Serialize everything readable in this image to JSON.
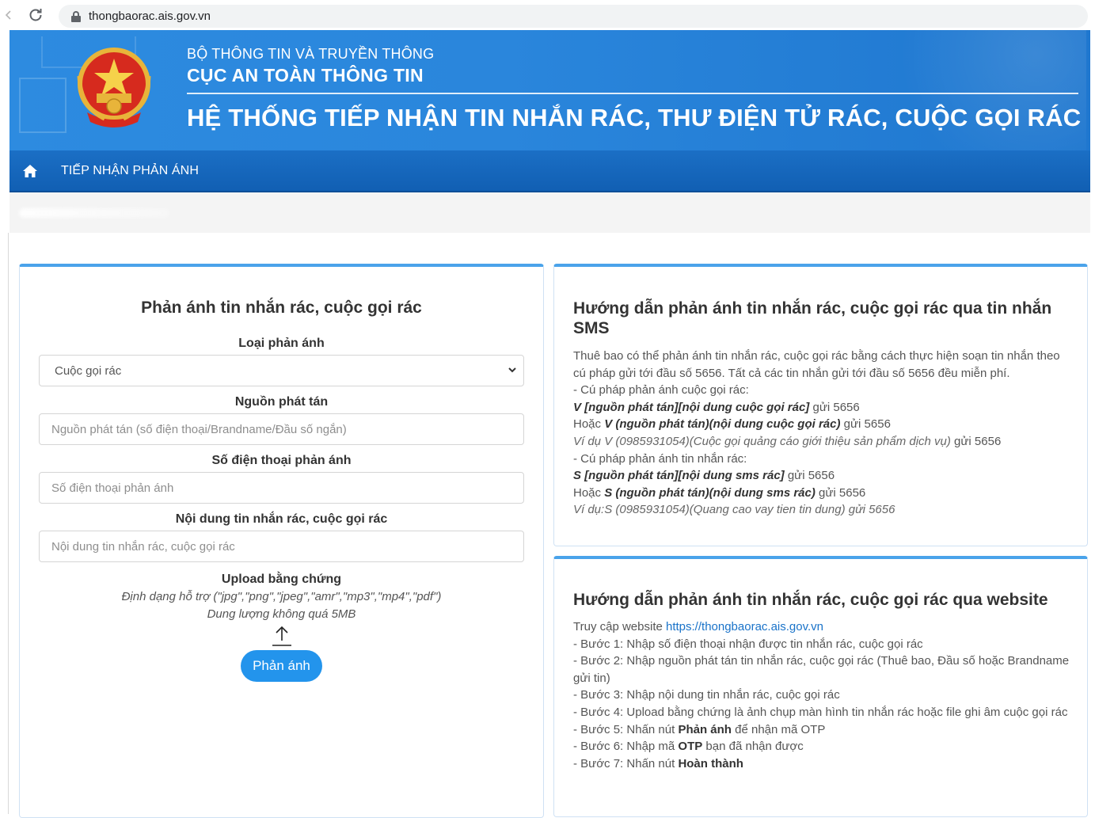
{
  "browser": {
    "url": "thongbaorac.ais.gov.vn"
  },
  "header": {
    "ministry": "BỘ THÔNG TIN VÀ TRUYỀN THÔNG",
    "agency": "CỤC AN TOÀN THÔNG TIN",
    "system_title": "HỆ THỐNG TIẾP NHẬN TIN NHẮN RÁC, THƯ ĐIỆN TỬ RÁC, CUỘC GỌI RÁC"
  },
  "nav": {
    "link": "TIẾP NHẬN PHẢN ÁNH"
  },
  "form": {
    "title": "Phản ánh tin nhắn rác, cuộc gọi rác",
    "type_label": "Loại phản ánh",
    "type_value": "Cuộc gọi rác",
    "source_label": "Nguồn phát tán",
    "source_placeholder": "Nguồn phát tán (số điện thoại/Brandname/Đầu số ngắn)",
    "phone_label": "Số điện thoại phản ánh",
    "phone_placeholder": "Số điện thoại phản ánh",
    "content_label": "Nội dung tin nhắn rác, cuộc gọi rác",
    "content_placeholder": "Nội dung tin nhắn rác, cuộc gọi rác",
    "upload_label": "Upload bằng chứng",
    "upload_formats": "Định dạng hỗ trợ (\"jpg\",\"png\",\"jpeg\",\"amr\",\"mp3\",\"mp4\",\"pdf\")",
    "upload_size": "Dung lượng không quá 5MB",
    "submit_label": "Phản ánh"
  },
  "sms_guide": {
    "title": "Hướng dẫn phản ánh tin nhắn rác, cuộc gọi rác qua tin nhắn SMS",
    "intro": "Thuê bao có thể phản ánh tin nhắn rác, cuộc gọi rác bằng cách thực hiện soạn tin nhắn theo cú pháp gửi tới đầu số 5656. Tất cả các tin nhắn gửi tới đầu số 5656 đều miễn phí.",
    "call_heading": "- Cú pháp phản ánh cuộc gọi rác:",
    "call_syntax1": "V [nguồn phát tán][nội dung cuộc gọi rác]",
    "call_send1": " gửi 5656",
    "call_or": "Hoặc ",
    "call_syntax2": "V (nguồn phát tán)(nội dung cuộc gọi rác)",
    "call_send2": " gửi 5656",
    "call_example": "Ví dụ V (0985931054)(Cuộc gọi quảng cáo giới thiệu sản phẩm dịch vụ)",
    "call_example_send": " gửi 5656",
    "sms_heading": "- Cú pháp phản ánh tin nhắn rác:",
    "sms_syntax1": "S [nguồn phát tán][nội dung sms rác]",
    "sms_send1": " gửi 5656",
    "sms_or": "Hoặc ",
    "sms_syntax2": "S (nguồn phát tán)(nội dung sms rác)",
    "sms_send2": " gửi 5656",
    "sms_example": "Ví dụ:S (0985931054)(Quang cao vay tien tin dung) gửi 5656"
  },
  "web_guide": {
    "title": "Hướng dẫn phản ánh tin nhắn rác, cuộc gọi rác qua website",
    "access": "Truy cập website ",
    "access_link": "https://thongbaorac.ais.gov.vn",
    "step1": "- Bước 1: Nhập số điện thoại nhận được tin nhắn rác, cuộc gọi rác",
    "step2": "- Bước 2: Nhập nguồn phát tán tin nhắn rác, cuộc gọi rác (Thuê bao, Đầu số hoặc Brandname gửi tin)",
    "step3": "- Bước 3: Nhập nội dung tin nhắn rác, cuộc gọi rác",
    "step4": "- Bước 4: Upload bằng chứng là ảnh chụp màn hình tin nhắn rác hoặc file ghi âm cuộc gọi rác",
    "step5_pre": "- Bước 5: Nhấn nút ",
    "step5_bold": "Phản ánh",
    "step5_post": " để nhận mã OTP",
    "step6_pre": "- Bước 6: Nhập mã ",
    "step6_bold": "OTP",
    "step6_post": " bạn đã nhận được",
    "step7_pre": "- Bước 7: Nhấn nút ",
    "step7_bold": "Hoàn thành"
  },
  "colors": {
    "header_blue": "#2a86dc",
    "nav_blue": "#115fb3",
    "panel_accent": "#4aa3ea",
    "button_blue": "#2394ec"
  }
}
